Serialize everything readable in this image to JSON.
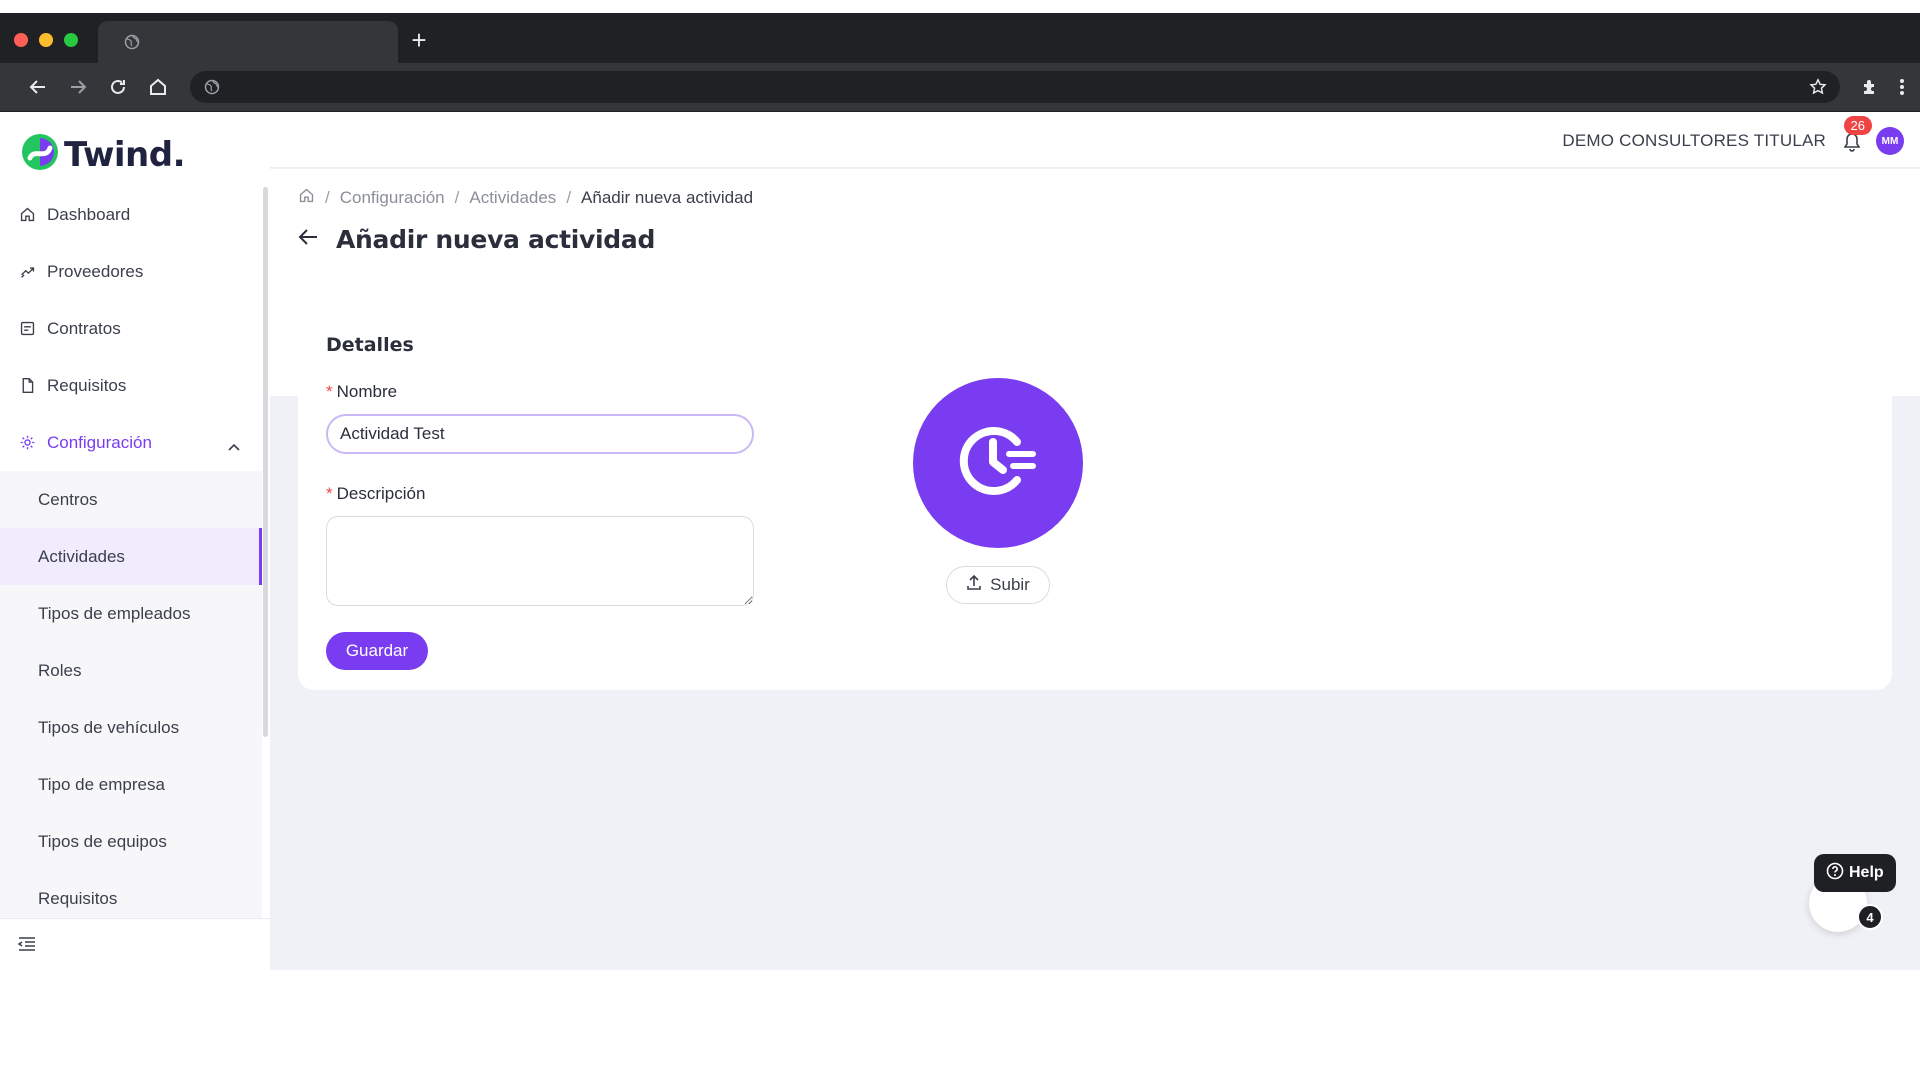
{
  "brand": {
    "name": "Twind.",
    "accent": "#7a3cf0"
  },
  "sidebar": {
    "items": [
      {
        "label": "Dashboard",
        "icon": "home-icon"
      },
      {
        "label": "Proveedores",
        "icon": "handshake-icon"
      },
      {
        "label": "Contratos",
        "icon": "contract-icon"
      },
      {
        "label": "Requisitos",
        "icon": "document-icon"
      },
      {
        "label": "Configuración",
        "icon": "gear-icon"
      }
    ],
    "submenu": [
      "Centros",
      "Actividades",
      "Tipos de empleados",
      "Roles",
      "Tipos de vehículos",
      "Tipo de empresa",
      "Tipos de equipos",
      "Requisitos"
    ],
    "selected": "Actividades"
  },
  "header": {
    "company": "DEMO CONSULTORES TITULAR",
    "notifications": "26",
    "avatar_initials": "MM"
  },
  "breadcrumb": {
    "items": [
      "Configuración",
      "Actividades"
    ],
    "current": "Añadir nueva actividad"
  },
  "page": {
    "title": "Añadir nueva actividad"
  },
  "form": {
    "section_title": "Detalles",
    "required_mark": "*",
    "name_label": "Nombre",
    "name_value": "Actividad Test",
    "description_label": "Descripción",
    "description_value": "",
    "save_label": "Guardar",
    "upload_label": "Subir"
  },
  "help": {
    "label": "Help",
    "count": "4"
  }
}
